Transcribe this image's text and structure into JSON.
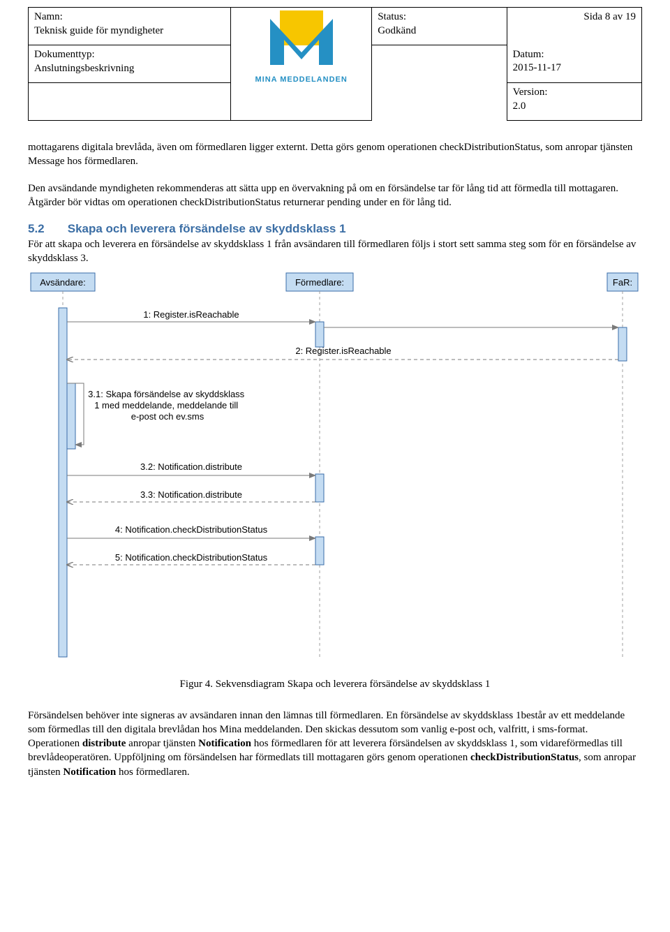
{
  "header": {
    "name_label": "Namn:",
    "name_value": "Teknisk guide för myndigheter",
    "doctype_label": "Dokumenttyp:",
    "doctype_value": "Anslutningsbeskrivning",
    "status_label": "Status:",
    "status_value": "Godkänd",
    "page_label": "Sida 8 av 19",
    "date_label": "Datum:",
    "date_value": "2015-11-17",
    "version_label": "Version:",
    "version_value": "2.0",
    "logo_text": "MINA MEDDELANDEN"
  },
  "para1": "mottagarens digitala brevlåda, även om förmedlaren ligger externt. Detta görs genom operationen checkDistributionStatus, som anropar tjänsten Message hos förmedlaren.",
  "para2": "Den avsändande myndigheten rekommenderas att sätta upp en övervakning på om en försändelse tar för lång tid att förmedla till mottagaren. Åtgärder bör vidtas om operationen checkDistributionStatus returnerar pending under en för lång tid.",
  "section": {
    "num": "5.2",
    "title": "Skapa och leverera försändelse av skyddsklass 1",
    "lead": "För att skapa och leverera en försändelse av skyddsklass 1 från avsändaren till förmedlaren följs i stort sett samma steg som för en försändelse av skyddsklass 3."
  },
  "diagram": {
    "actor_sender": "Avsändare:",
    "actor_broker": "Förmedlare:",
    "actor_far": "FaR:",
    "msg1": "1: Register.isReachable",
    "msg2": "2: Register.isReachable",
    "msg31": "3.1: Skapa försändelse av skyddsklass 1 med meddelande, meddelande till e-post och ev.sms",
    "msg32": "3.2: Notification.distribute",
    "msg33": "3.3: Notification.distribute",
    "msg4": "4: Notification.checkDistributionStatus",
    "msg5": "5: Notification.checkDistributionStatus"
  },
  "caption": "Figur 4. Sekvensdiagram Skapa och leverera försändelse av skyddsklass 1",
  "para3a": "Försändelsen behöver inte signeras av avsändaren innan den lämnas till förmedlaren. En försändelse av skyddsklass 1består av ett meddelande som förmedlas till den digitala brevlådan hos Mina meddelanden. Den skickas dessutom som vanlig e-post och, valfritt, i sms-format. Operationen ",
  "para3_bold1": "distribute",
  "para3b": " anropar tjänsten ",
  "para3_bold2": "Notification",
  "para3c": " hos förmedlaren för att leverera försändelsen av skyddsklass 1, som vidareförmedlas till brevlådeoperatören. Uppföljning om försändelsen har förmedlats till mottagaren görs genom operationen ",
  "para3_bold3": "checkDistributionStatus",
  "para3d": ", som anropar tjänsten ",
  "para3_bold4": "Notification",
  "para3e": " hos förmedlaren."
}
